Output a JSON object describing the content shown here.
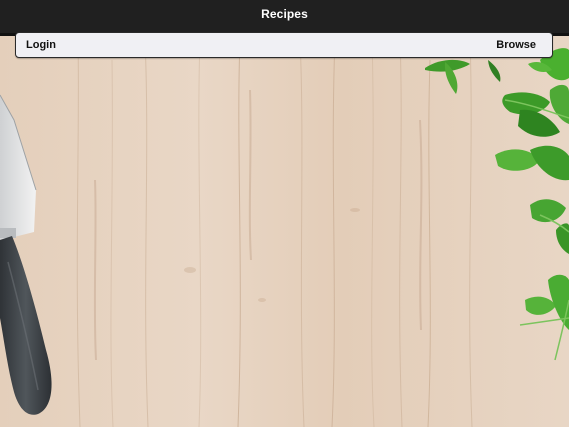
{
  "app": {
    "title": "Recipes"
  },
  "nav": {
    "login_label": "Login",
    "browse_label": "Browse"
  },
  "background": {
    "description_icon": "wood-board-knife-parsley-photo"
  },
  "colors": {
    "titlebar_bg": "#202020",
    "navbar_bg": "#f0f0f4",
    "wood": "#e7d4c2",
    "knife_handle": "#3f4448",
    "parsley": "#3f9a2a"
  }
}
